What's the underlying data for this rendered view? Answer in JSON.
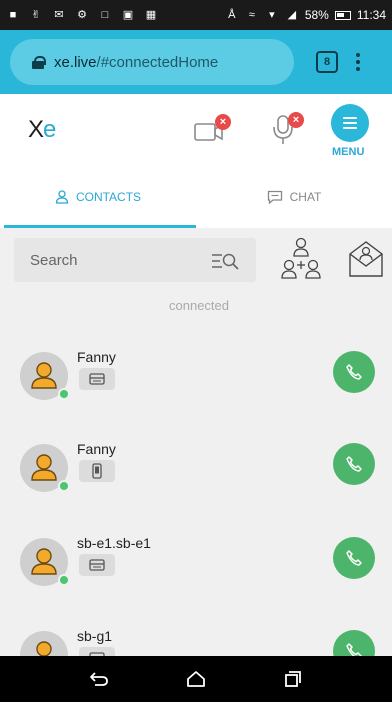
{
  "status_bar": {
    "battery": "58%",
    "time": "11:34"
  },
  "browser": {
    "domain": "xe.live",
    "path": "/#connectedHome",
    "tab_count": "8"
  },
  "app": {
    "logo_letter_x": "X",
    "logo_letter_e": "e",
    "menu_label": "MENU",
    "camera_badge": "×",
    "mic_badge": "×"
  },
  "tabs": [
    {
      "label": "CONTACTS",
      "active": true
    },
    {
      "label": "CHAT",
      "active": false
    }
  ],
  "search": {
    "placeholder": "Search"
  },
  "section_label": "connected",
  "contacts": [
    {
      "name": "Fanny",
      "device": "desktop",
      "status": "online"
    },
    {
      "name": "Fanny",
      "device": "mobile",
      "status": "online"
    },
    {
      "name": "sb-e1.sb-e1",
      "device": "desktop",
      "status": "online"
    },
    {
      "name": "sb-g1",
      "device": "desktop",
      "status": "online"
    }
  ],
  "colors": {
    "accent": "#2bb7d9",
    "call_green": "#4db56b",
    "online": "#4cc56e",
    "badge_red": "#e84a4a",
    "avatar_orange": "#f3a92c"
  }
}
